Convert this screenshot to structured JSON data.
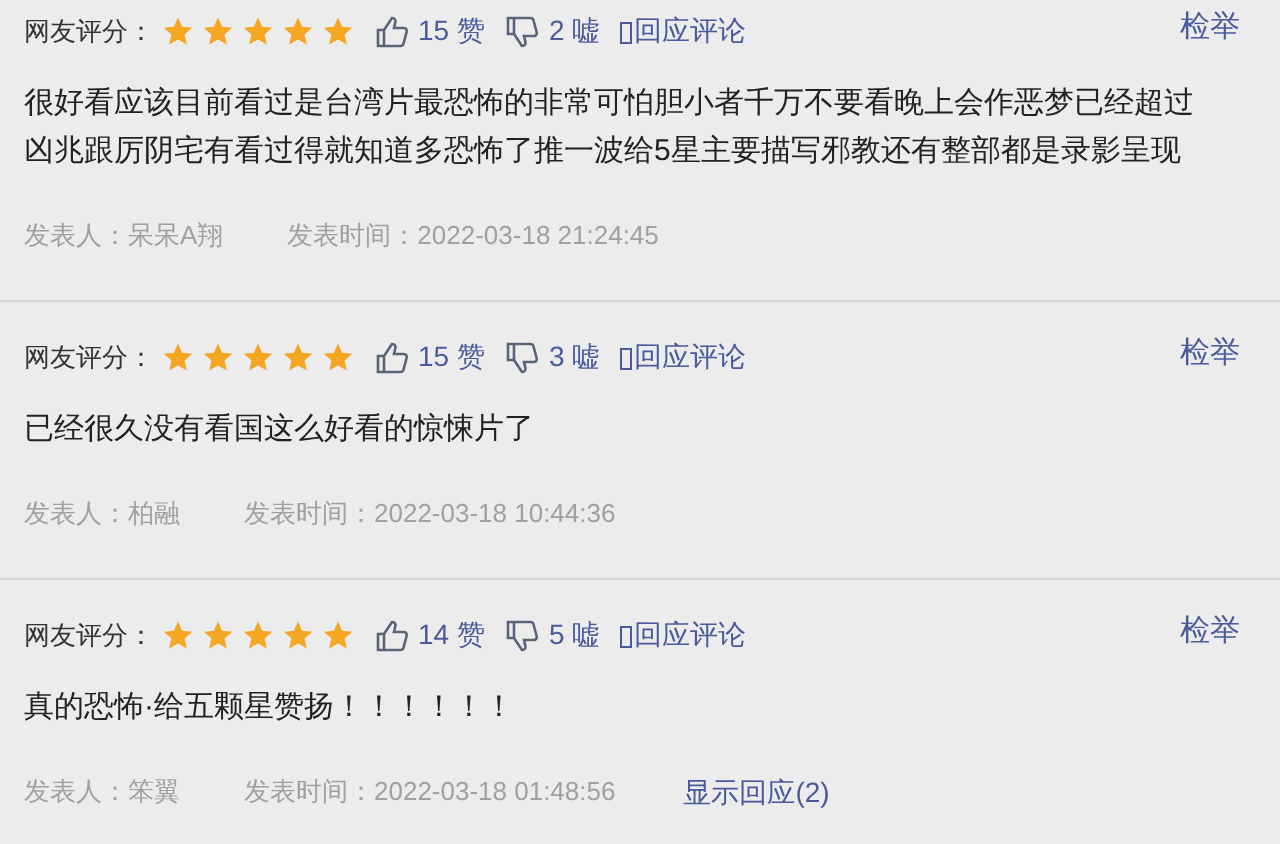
{
  "comments": [
    {
      "rating_label": "网友评分：",
      "stars": 5,
      "likes": "15",
      "like_unit": "赞",
      "dislikes": "2",
      "dislike_unit": "嘘",
      "reply_link": "回应评论",
      "report": "检举",
      "text": "很好看应该目前看过是台湾片最恐怖的非常可怕胆小者千万不要看晚上会作恶梦已经超过凶兆跟厉阴宅有看过得就知道多恐怖了推一波给5星主要描写邪教还有整部都是录影呈现",
      "author": "发表人：呆呆A翔",
      "time": "发表时间：2022-03-18 21:24:45"
    },
    {
      "rating_label": "网友评分：",
      "stars": 5,
      "likes": "15",
      "like_unit": "赞",
      "dislikes": "3",
      "dislike_unit": "嘘",
      "reply_link": "回应评论",
      "report": "检举",
      "text": "已经很久没有看国这么好看的惊悚片了",
      "author": "发表人：柏融",
      "time": "发表时间：2022-03-18 10:44:36"
    },
    {
      "rating_label": "网友评分：",
      "stars": 5,
      "likes": "14",
      "like_unit": "赞",
      "dislikes": "5",
      "dislike_unit": "嘘",
      "reply_link": "回应评论",
      "report": "检举",
      "text": "真的恐怖·给五颗星赞扬！！！！！！",
      "author": "发表人：笨翼",
      "time": "发表时间：2022-03-18 01:48:56",
      "show_replies": "显示回应(2)"
    }
  ]
}
